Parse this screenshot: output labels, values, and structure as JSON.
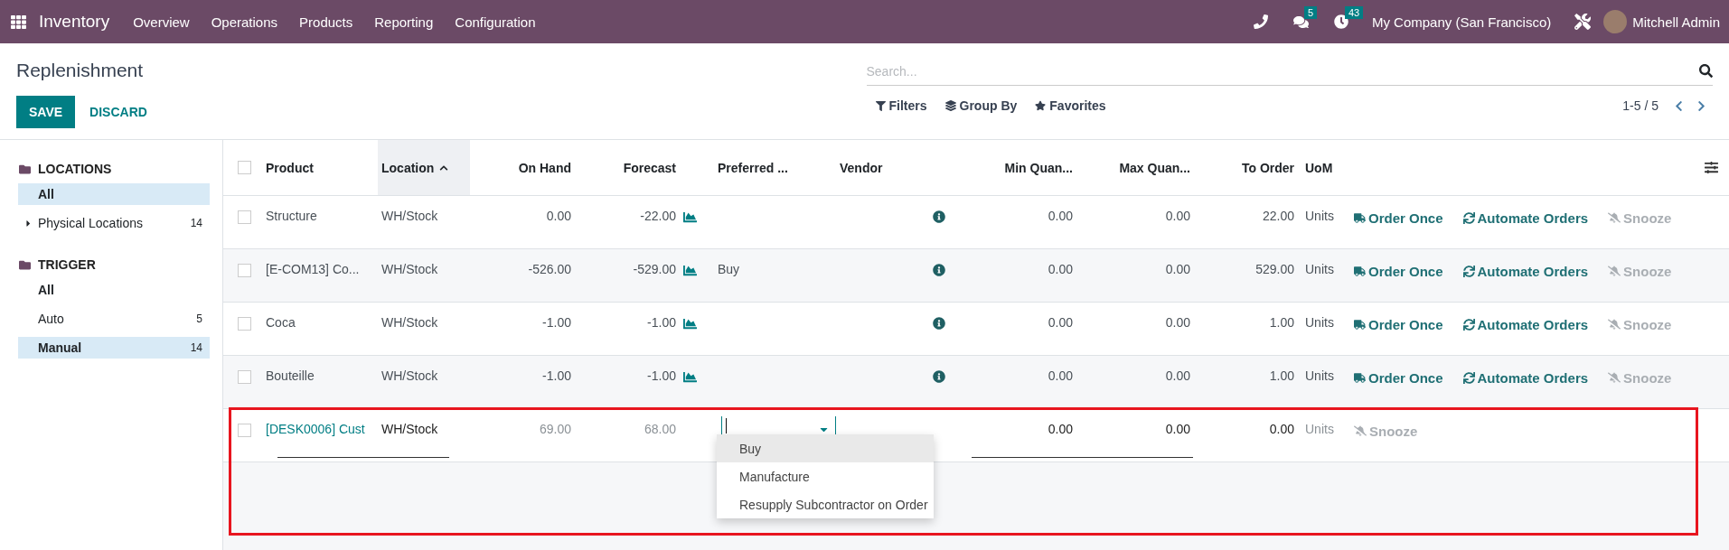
{
  "navbar": {
    "app_name": "Inventory",
    "menu": [
      "Overview",
      "Operations",
      "Products",
      "Reporting",
      "Configuration"
    ],
    "messages_count": "5",
    "activities_count": "43",
    "company": "My Company (San Francisco)",
    "user": "Mitchell Admin"
  },
  "control_panel": {
    "title": "Replenishment",
    "save": "SAVE",
    "discard": "DISCARD",
    "search": {
      "placeholder": "Search..."
    },
    "filters": [
      "Filters",
      "Group By",
      "Favorites"
    ],
    "pager": "1-5 / 5"
  },
  "sidebar": [
    {
      "title": "LOCATIONS",
      "items": [
        {
          "label": "All",
          "selected": true
        },
        {
          "label": "Physical Locations",
          "count": "14",
          "expandable": true,
          "selected": false
        }
      ]
    },
    {
      "title": "TRIGGER",
      "items": [
        {
          "label": "All",
          "selected": false,
          "bold": true
        },
        {
          "label": "Auto",
          "count": "5",
          "selected": false
        },
        {
          "label": "Manual",
          "count": "14",
          "selected": true
        }
      ]
    }
  ],
  "table": {
    "all_checked": false,
    "columns": [
      {
        "label": "Product",
        "sorted": false
      },
      {
        "label": "Location",
        "sorted": true
      },
      {
        "label": "On Hand",
        "sorted": false
      },
      {
        "label": "Forecast",
        "sorted": false
      },
      {
        "label": "Preferred ...",
        "sorted": false
      },
      {
        "label": "Vendor",
        "sorted": false
      },
      {
        "label": "Min Quan...",
        "sorted": false
      },
      {
        "label": "Max Quan...",
        "sorted": false
      },
      {
        "label": "To Order",
        "sorted": false
      },
      {
        "label": "UoM",
        "sorted": false
      }
    ],
    "rows": [
      {
        "checked": false,
        "product": "Structure",
        "location": "WH/Stock",
        "on_hand": "0.00",
        "forecast": "-22.00",
        "min": "0.00",
        "max": "0.00",
        "to_order": "22.00",
        "uom": "Units",
        "editing": false,
        "actions": [
          {
            "kind": "order",
            "label": "Order Once"
          },
          {
            "kind": "automate",
            "label": "Automate Orders"
          },
          {
            "kind": "snooze",
            "label": "Snooze"
          }
        ]
      },
      {
        "checked": false,
        "product": "[E-COM13] Co...",
        "location": "WH/Stock",
        "on_hand": "-526.00",
        "forecast": "-529.00",
        "route": "Buy",
        "min": "0.00",
        "max": "0.00",
        "to_order": "529.00",
        "uom": "Units",
        "editing": false,
        "actions": [
          {
            "kind": "order",
            "label": "Order Once"
          },
          {
            "kind": "automate",
            "label": "Automate Orders"
          },
          {
            "kind": "snooze",
            "label": "Snooze"
          }
        ]
      },
      {
        "checked": false,
        "product": "Coca",
        "location": "WH/Stock",
        "on_hand": "-1.00",
        "forecast": "-1.00",
        "min": "0.00",
        "max": "0.00",
        "to_order": "1.00",
        "uom": "Units",
        "editing": false,
        "actions": [
          {
            "kind": "order",
            "label": "Order Once"
          },
          {
            "kind": "automate",
            "label": "Automate Orders"
          },
          {
            "kind": "snooze",
            "label": "Snooze"
          }
        ]
      },
      {
        "checked": false,
        "product": "Bouteille",
        "location": "WH/Stock",
        "on_hand": "-1.00",
        "forecast": "-1.00",
        "min": "0.00",
        "max": "0.00",
        "to_order": "1.00",
        "uom": "Units",
        "editing": false,
        "actions": [
          {
            "kind": "order",
            "label": "Order Once"
          },
          {
            "kind": "automate",
            "label": "Automate Orders"
          },
          {
            "kind": "snooze",
            "label": "Snooze"
          }
        ]
      },
      {
        "checked": false,
        "product": "[DESK0006] Cust",
        "location": "WH/Stock",
        "on_hand": "69.00",
        "forecast": "68.00",
        "min": "0.00",
        "max": "0.00",
        "to_order": "0.00",
        "uom": "Units",
        "editing": true,
        "highlighted": true,
        "actions": [
          {
            "kind": "snooze",
            "label": "Snooze"
          }
        ],
        "route_options": [
          {
            "label": "Buy",
            "selected": true
          },
          {
            "label": "Manufacture",
            "selected": false
          },
          {
            "label": "Resupply Subcontractor on Order",
            "selected": false
          }
        ]
      }
    ]
  }
}
